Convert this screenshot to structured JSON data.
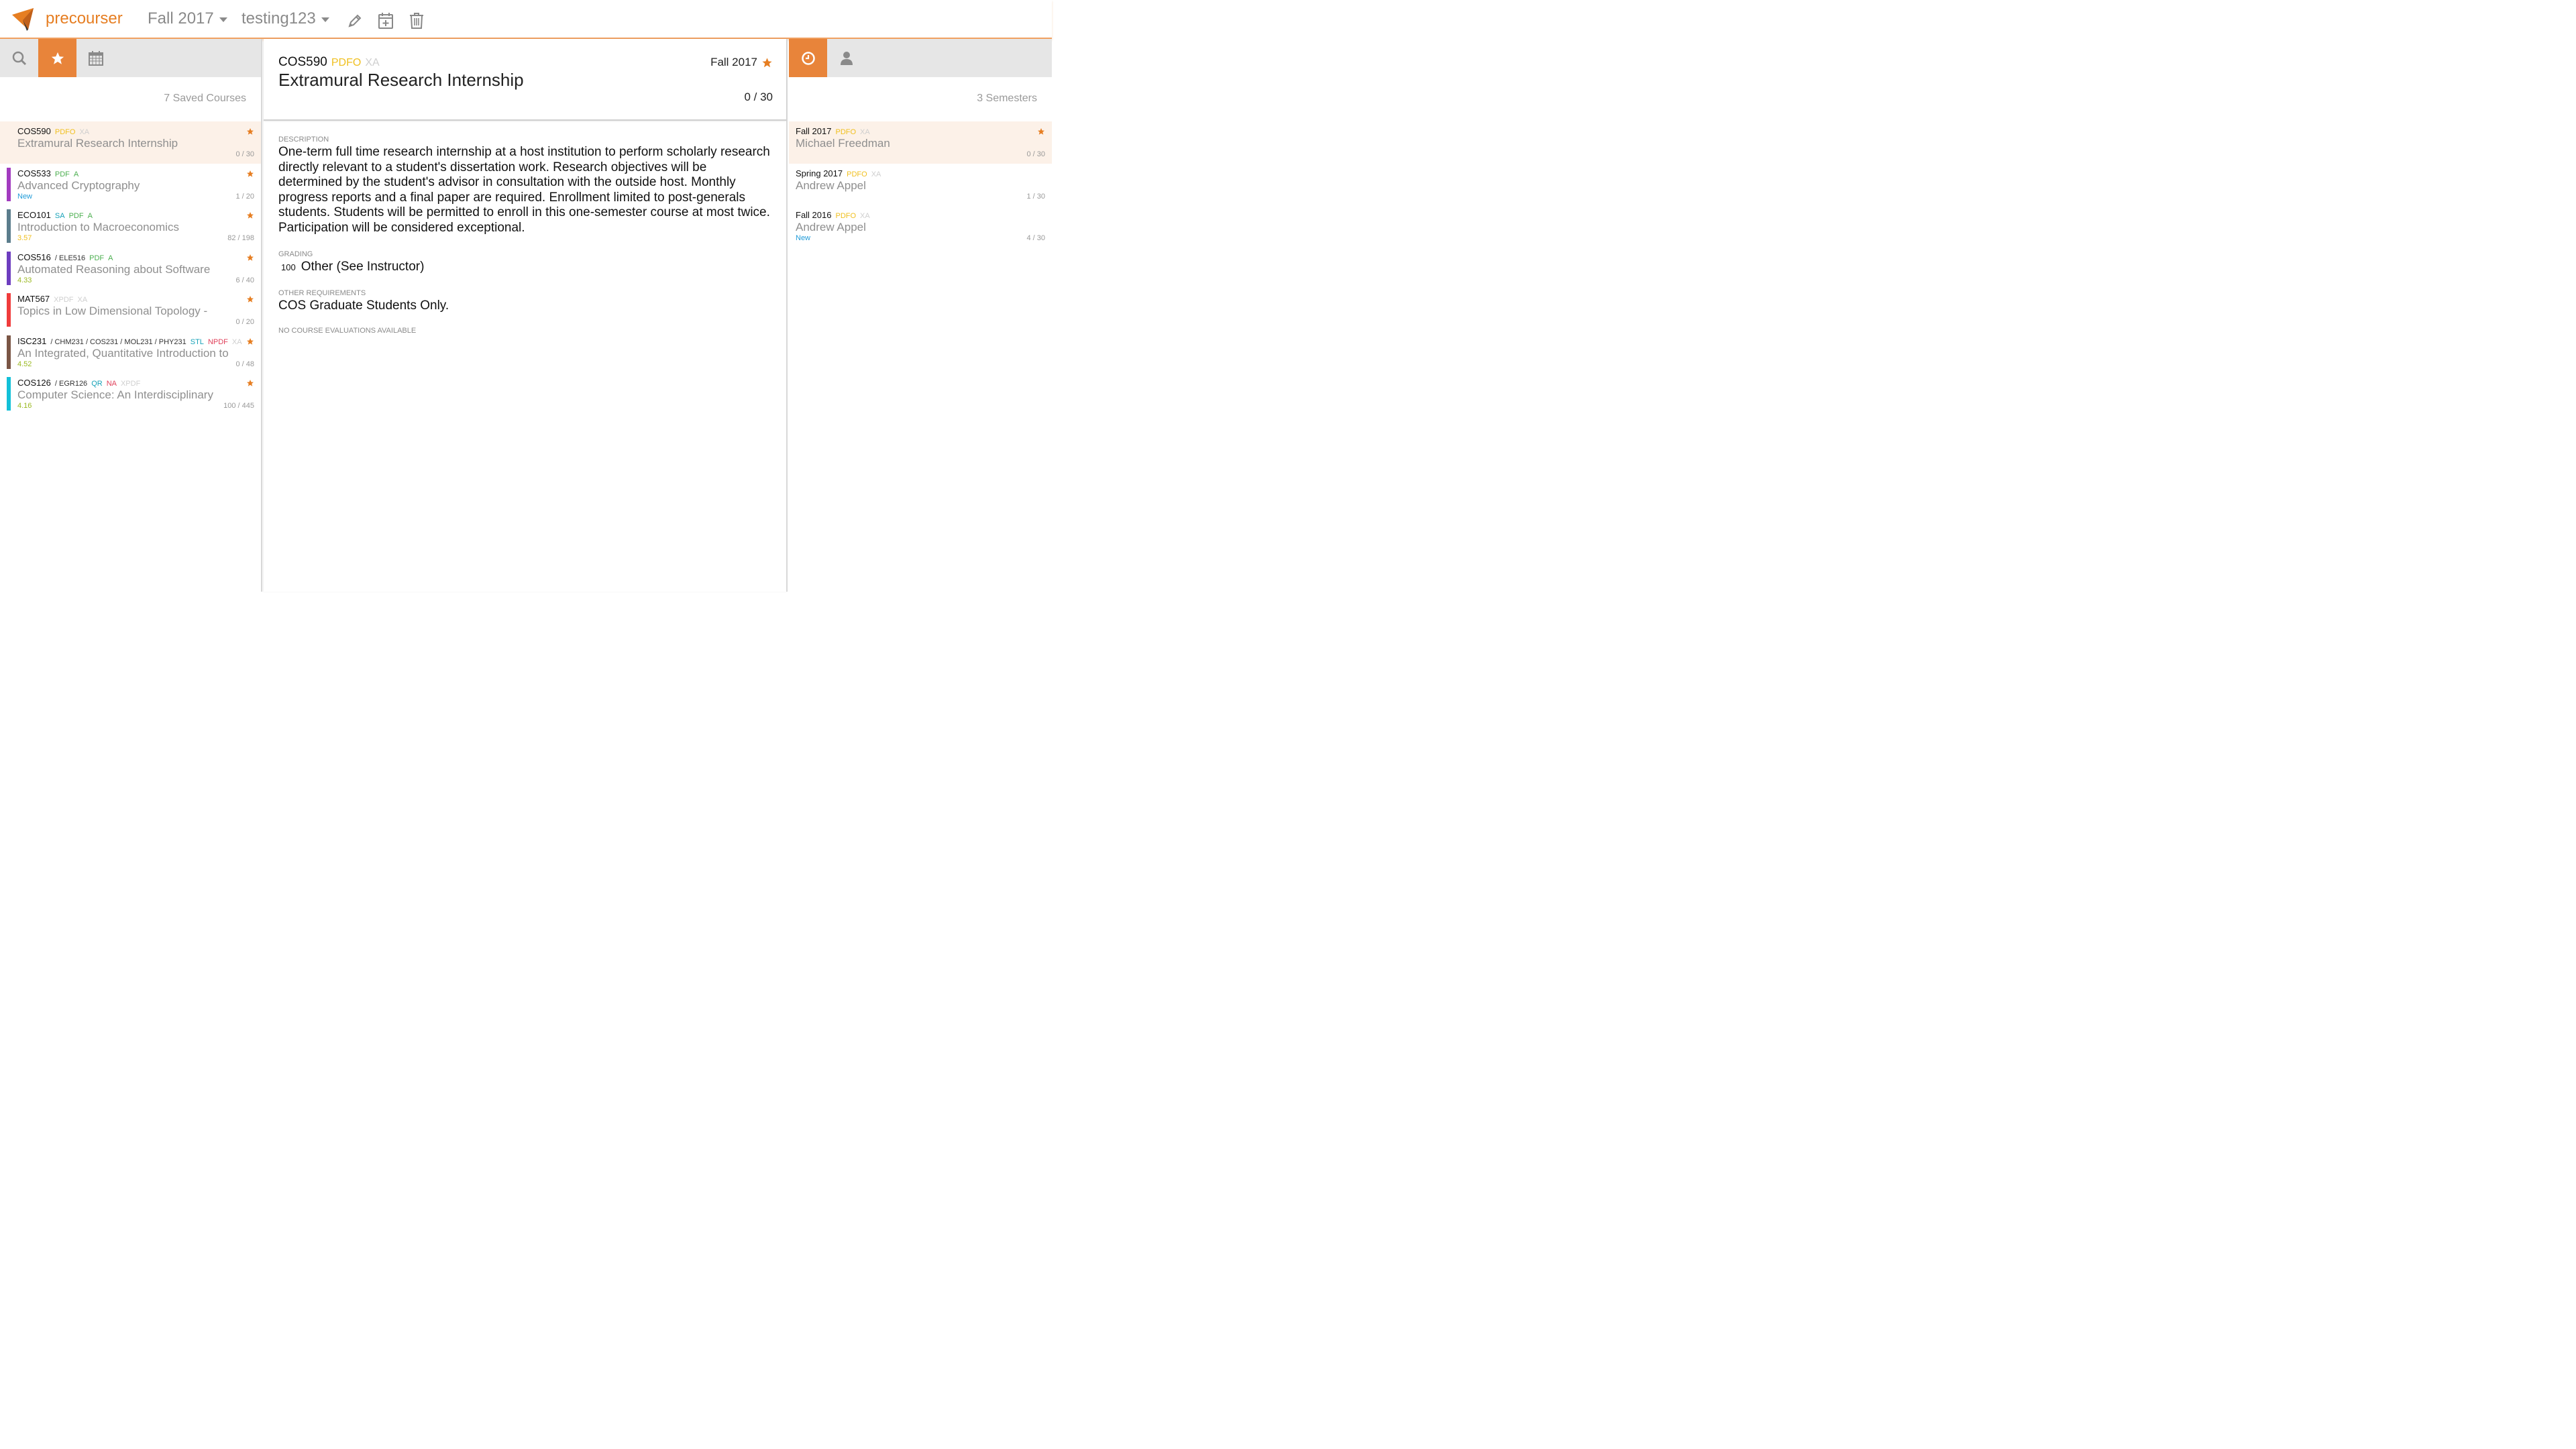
{
  "colors": {
    "accent": "#e67e22",
    "tab_active": "#e8843a"
  },
  "navbar": {
    "brand": "precourser",
    "semester": "Fall 2017",
    "schedule": "testing123",
    "icons": [
      "pencil-icon",
      "calendar-plus-icon",
      "trash-icon"
    ]
  },
  "left": {
    "tabs": [
      "search-icon",
      "star-icon",
      "calendar-icon"
    ],
    "count_label": "7 Saved Courses",
    "courses": [
      {
        "code": "COS590",
        "crosslists": "",
        "tags": [
          {
            "text": "PDFO",
            "color": "#f0c020"
          },
          {
            "text": "XA",
            "color": "#cfcfcf"
          }
        ],
        "title": "Extramural Research Internship",
        "sub": "",
        "sub_color": "",
        "count": "0 / 30",
        "bar": "",
        "selected": true
      },
      {
        "code": "COS533",
        "crosslists": "",
        "tags": [
          {
            "text": "PDF",
            "color": "#4caf50"
          },
          {
            "text": "A",
            "color": "#4caf50"
          }
        ],
        "title": "Advanced Cryptography",
        "sub": "New",
        "sub_color": "#1f9bd8",
        "count": "1 / 20",
        "bar": "#a23bbf",
        "selected": false
      },
      {
        "code": "ECO101",
        "crosslists": "",
        "tags": [
          {
            "text": "SA",
            "color": "#17a2b8"
          },
          {
            "text": "PDF",
            "color": "#4caf50"
          },
          {
            "text": "A",
            "color": "#4caf50"
          }
        ],
        "title": "Introduction to Macroeconomics",
        "sub": "3.57",
        "sub_color": "#f0c020",
        "count": "82 / 198",
        "bar": "#5b7d8c",
        "selected": false
      },
      {
        "code": "COS516",
        "crosslists": "/ ELE516",
        "tags": [
          {
            "text": "PDF",
            "color": "#4caf50"
          },
          {
            "text": "A",
            "color": "#4caf50"
          }
        ],
        "title": "Automated Reasoning about Software",
        "sub": "4.33",
        "sub_color": "#9ab820",
        "count": "6 / 40",
        "bar": "#6d3dbf",
        "selected": false
      },
      {
        "code": "MAT567",
        "crosslists": "",
        "tags": [
          {
            "text": "XPDF",
            "color": "#cfcfcf"
          },
          {
            "text": "XA",
            "color": "#cfcfcf"
          }
        ],
        "title": "Topics in Low Dimensional Topology -",
        "sub": "",
        "sub_color": "",
        "count": "0 / 20",
        "bar": "#f03c3c",
        "selected": false
      },
      {
        "code": "ISC231",
        "crosslists": "/ CHM231  / COS231  / MOL231  / PHY231",
        "tags": [
          {
            "text": "STL",
            "color": "#17a2b8"
          },
          {
            "text": "NPDF",
            "color": "#e0405a"
          },
          {
            "text": "XA",
            "color": "#cfcfcf"
          }
        ],
        "title": "An Integrated, Quantitative Introduction to",
        "sub": "4.52",
        "sub_color": "#9ab820",
        "count": "0 / 48",
        "bar": "#7a5545",
        "selected": false
      },
      {
        "code": "COS126",
        "crosslists": "/ EGR126",
        "tags": [
          {
            "text": "QR",
            "color": "#17a2b8"
          },
          {
            "text": "NA",
            "color": "#e0405a"
          },
          {
            "text": "XPDF",
            "color": "#cfcfcf"
          }
        ],
        "title": "Computer Science: An Interdisciplinary",
        "sub": "4.16",
        "sub_color": "#9ab820",
        "count": "100 / 445",
        "bar": "#12c0d8",
        "selected": false
      }
    ]
  },
  "detail": {
    "code": "COS590",
    "tag1": "PDFO",
    "tag2": "XA",
    "title": "Extramural Research Internship",
    "term": "Fall 2017",
    "enrollment": "0 / 30",
    "description_label": "DESCRIPTION",
    "description": "One-term full time research internship at a host institution to perform scholarly research directly relevant to a student's dissertation work. Research objectives will be determined by the student's advisor in consultation with the outside host. Monthly progress reports and a final paper are required. Enrollment limited to post-generals students. Students will be permitted to enroll in this one-semester course at most twice. Participation will be considered exceptional.",
    "grading_label": "GRADING",
    "grading_pct": "100",
    "grading_text": "Other (See Instructor)",
    "other_label": "OTHER REQUIREMENTS",
    "other_text": "COS Graduate Students Only.",
    "no_eval": "NO COURSE EVALUATIONS AVAILABLE"
  },
  "right": {
    "tabs": [
      "clock-icon",
      "user-icon"
    ],
    "count_label": "3 Semesters",
    "semesters": [
      {
        "term": "Fall 2017",
        "tags": [
          {
            "text": "PDFO",
            "color": "#f0c020"
          },
          {
            "text": "XA",
            "color": "#cfcfcf"
          }
        ],
        "instructor": "Michael Freedman",
        "sub": "",
        "sub_color": "",
        "count": "0 / 30",
        "selected": true
      },
      {
        "term": "Spring 2017",
        "tags": [
          {
            "text": "PDFO",
            "color": "#f0c020"
          },
          {
            "text": "XA",
            "color": "#cfcfcf"
          }
        ],
        "instructor": "Andrew Appel",
        "sub": "",
        "sub_color": "",
        "count": "1 / 30",
        "selected": false
      },
      {
        "term": "Fall 2016",
        "tags": [
          {
            "text": "PDFO",
            "color": "#f0c020"
          },
          {
            "text": "XA",
            "color": "#cfcfcf"
          }
        ],
        "instructor": "Andrew Appel",
        "sub": "New",
        "sub_color": "#1f9bd8",
        "count": "4 / 30",
        "selected": false
      }
    ]
  }
}
